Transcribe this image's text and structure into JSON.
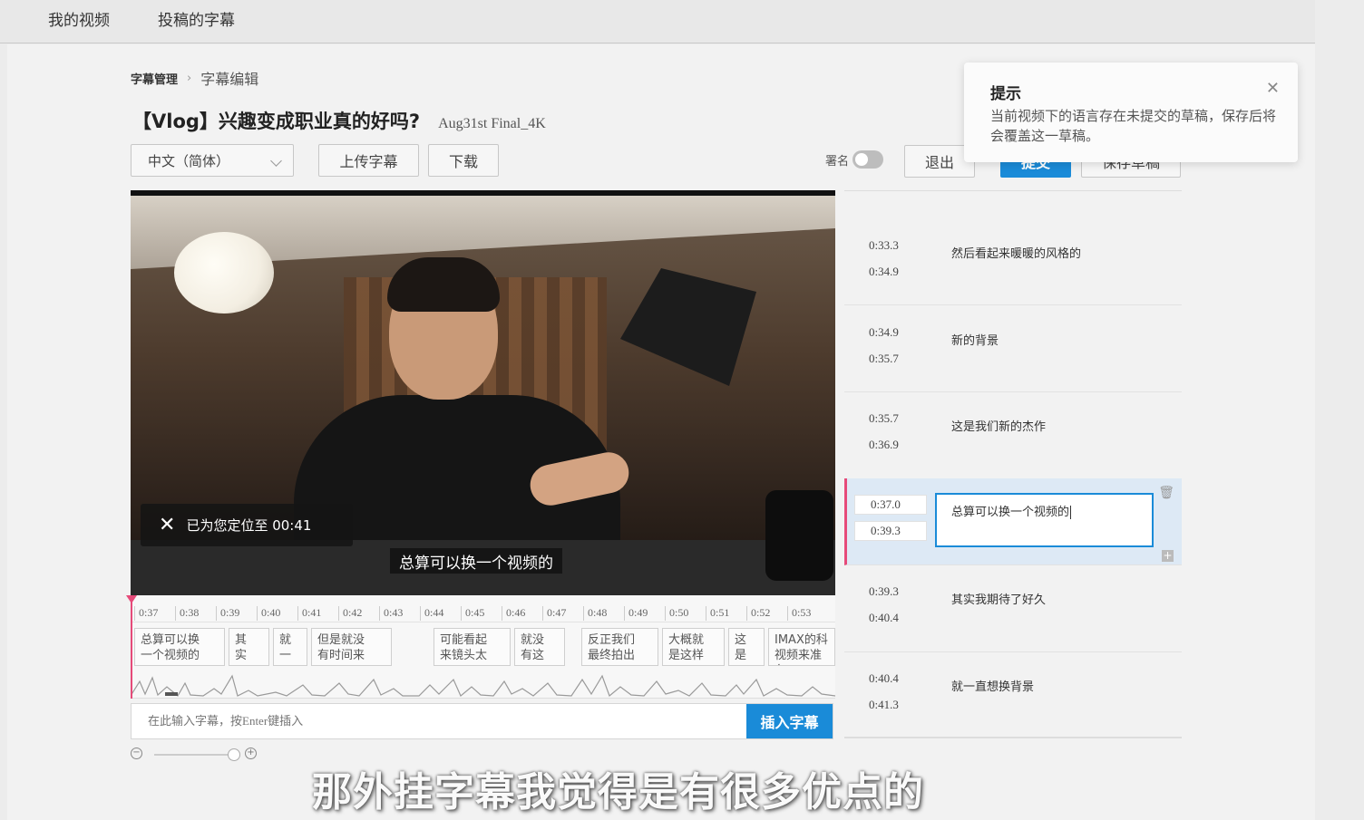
{
  "topnav": {
    "items": [
      "我的视频",
      "投稿的字幕"
    ]
  },
  "breadcrumb": {
    "root": "字幕管理",
    "current": "字幕编辑"
  },
  "header": {
    "title": "【Vlog】兴趣变成职业真的好吗?",
    "subtitle": "Aug31st Final_4K"
  },
  "toolbar": {
    "language": "中文（简体）",
    "upload_label": "上传字幕",
    "download_label": "下载",
    "sign_label": "署名",
    "sign_enabled": false,
    "exit_label": "退出",
    "submit_label": "提交",
    "save_draft_label": "保存草稿"
  },
  "video": {
    "toast": "已为您定位至 00:41",
    "subtitle": "总算可以换一个视频的"
  },
  "timeline": {
    "ticks": [
      "0:37",
      "0:38",
      "0:39",
      "0:40",
      "0:41",
      "0:42",
      "0:43",
      "0:44",
      "0:45",
      "0:46",
      "0:47",
      "0:48",
      "0:49",
      "0:50",
      "0:51",
      "0:52",
      "0:53"
    ],
    "segments": [
      "总算可以换\n一个视频的",
      "其\n实",
      "就\n一",
      "但是就没\n有时间来",
      "可能看起\n来镜头太",
      "就没\n有这",
      "反正我们\n最终拍出",
      "大概就\n是这样",
      "这\n是",
      "IMAX的科\n视频来准备"
    ]
  },
  "insert": {
    "placeholder": "在此输入字幕，按Enter键插入",
    "button_label": "插入字幕"
  },
  "subtitles": [
    {
      "start": "0:33.3",
      "end": "0:34.9",
      "text": "然后看起来暖暖的风格的"
    },
    {
      "start": "0:34.9",
      "end": "0:35.7",
      "text": "新的背景"
    },
    {
      "start": "0:35.7",
      "end": "0:36.9",
      "text": "这是我们新的杰作"
    },
    {
      "start": "0:37.0",
      "end": "0:39.3",
      "text": "总算可以换一个视频的",
      "active": true
    },
    {
      "start": "0:39.3",
      "end": "0:40.4",
      "text": "其实我期待了好久"
    },
    {
      "start": "0:40.4",
      "end": "0:41.3",
      "text": "就一直想换背景"
    }
  ],
  "tip": {
    "title": "提示",
    "body": "当前视频下的语言存在未提交的草稿，保存后将会覆盖这一草稿。"
  },
  "overlay_caption": "那外挂字幕我觉得是有很多优点的",
  "colors": {
    "accent": "#1a8bd8",
    "playhead": "#e64a79"
  }
}
